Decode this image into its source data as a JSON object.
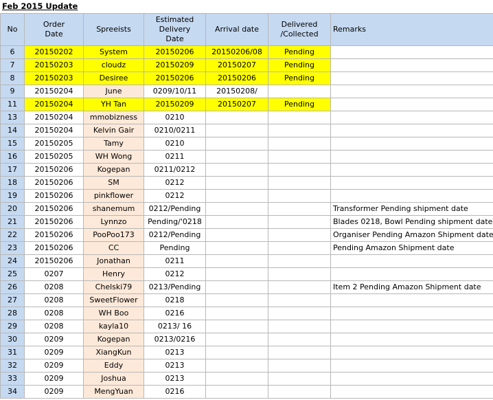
{
  "title": "Feb 2015 Update",
  "headers": {
    "no": "No",
    "order_date": "Order Date",
    "spreeists": "Spreeists",
    "est_delivery": "Estimated Delivery Date",
    "arrival": "Arrival date",
    "delivered": "Delivered /Collected",
    "remarks": "Remarks"
  },
  "colors": {
    "highlight": "#ffff00",
    "header": "#c5d9f1",
    "spreeist": "#fde9d9"
  },
  "rows": [
    {
      "no": "6",
      "order": "20150202",
      "name": "System",
      "est": "20150206",
      "arrival": "20150206/08",
      "delivered": "Pending",
      "remarks": "",
      "highlight": true
    },
    {
      "no": "7",
      "order": "20150203",
      "name": "cloudz",
      "est": "20150209",
      "arrival": "20150207",
      "delivered": "Pending",
      "remarks": "",
      "highlight": true
    },
    {
      "no": "8",
      "order": "20150203",
      "name": "Desiree",
      "est": "20150206",
      "arrival": "20150206",
      "delivered": "Pending",
      "remarks": "",
      "highlight": true
    },
    {
      "no": "9",
      "order": "20150204",
      "name": "June",
      "est": "0209/10/11",
      "arrival": "20150208/",
      "delivered": "",
      "remarks": "",
      "highlight": false
    },
    {
      "no": "11",
      "order": "20150204",
      "name": "YH Tan",
      "est": "20150209",
      "arrival": "20150207",
      "delivered": "Pending",
      "remarks": "",
      "highlight": true
    },
    {
      "no": "13",
      "order": "20150204",
      "name": "mmobizness",
      "est": "0210",
      "arrival": "",
      "delivered": "",
      "remarks": "",
      "highlight": false
    },
    {
      "no": "14",
      "order": "20150204",
      "name": "Kelvin Gair",
      "est": "0210/0211",
      "arrival": "",
      "delivered": "",
      "remarks": "",
      "highlight": false
    },
    {
      "no": "15",
      "order": "20150205",
      "name": "Tamy",
      "est": "0210",
      "arrival": "",
      "delivered": "",
      "remarks": "",
      "highlight": false
    },
    {
      "no": "16",
      "order": "20150205",
      "name": "WH Wong",
      "est": "0211",
      "arrival": "",
      "delivered": "",
      "remarks": "",
      "highlight": false
    },
    {
      "no": "17",
      "order": "20150206",
      "name": "Kogepan",
      "est": "0211/0212",
      "arrival": "",
      "delivered": "",
      "remarks": "",
      "highlight": false
    },
    {
      "no": "18",
      "order": "20150206",
      "name": "SM",
      "est": "0212",
      "arrival": "",
      "delivered": "",
      "remarks": "",
      "highlight": false
    },
    {
      "no": "19",
      "order": "20150206",
      "name": "pinkflower",
      "est": "0212",
      "arrival": "",
      "delivered": "",
      "remarks": "",
      "highlight": false
    },
    {
      "no": "20",
      "order": "20150206",
      "name": "shanemum",
      "est": "0212/Pending",
      "arrival": "",
      "delivered": "",
      "remarks": "Transformer Pending shipment date",
      "highlight": false
    },
    {
      "no": "21",
      "order": "20150206",
      "name": "Lynnzo",
      "est": "Pending/'0218",
      "arrival": "",
      "delivered": "",
      "remarks": "Blades 0218, Bowl Pending shipment date",
      "highlight": false
    },
    {
      "no": "22",
      "order": "20150206",
      "name": "PooPoo173",
      "est": "0212/Pending",
      "arrival": "",
      "delivered": "",
      "remarks": "Organiser Pending Amazon Shipment date",
      "highlight": false
    },
    {
      "no": "23",
      "order": "20150206",
      "name": "CC",
      "est": "Pending",
      "arrival": "",
      "delivered": "",
      "remarks": "Pending Amazon Shipment date",
      "highlight": false
    },
    {
      "no": "24",
      "order": "20150206",
      "name": "Jonathan",
      "est": "0211",
      "arrival": "",
      "delivered": "",
      "remarks": "",
      "highlight": false
    },
    {
      "no": "25",
      "order": "0207",
      "name": "Henry",
      "est": "0212",
      "arrival": "",
      "delivered": "",
      "remarks": "",
      "highlight": false
    },
    {
      "no": "26",
      "order": "0208",
      "name": "Chelski79",
      "est": "0213/Pending",
      "arrival": "",
      "delivered": "",
      "remarks": "Item 2 Pending Amazon Shipment date",
      "highlight": false
    },
    {
      "no": "27",
      "order": "0208",
      "name": "SweetFlower",
      "est": "0218",
      "arrival": "",
      "delivered": "",
      "remarks": "",
      "highlight": false
    },
    {
      "no": "28",
      "order": "0208",
      "name": "WH Boo",
      "est": "0216",
      "arrival": "",
      "delivered": "",
      "remarks": "",
      "highlight": false
    },
    {
      "no": "29",
      "order": "0208",
      "name": "kayla10",
      "est": "0213/ 16",
      "arrival": "",
      "delivered": "",
      "remarks": "",
      "highlight": false
    },
    {
      "no": "30",
      "order": "0209",
      "name": "Kogepan",
      "est": "0213/0216",
      "arrival": "",
      "delivered": "",
      "remarks": "",
      "highlight": false
    },
    {
      "no": "31",
      "order": "0209",
      "name": "XiangKun",
      "est": "0213",
      "arrival": "",
      "delivered": "",
      "remarks": "",
      "highlight": false
    },
    {
      "no": "32",
      "order": "0209",
      "name": "Eddy",
      "est": "0213",
      "arrival": "",
      "delivered": "",
      "remarks": "",
      "highlight": false
    },
    {
      "no": "33",
      "order": "0209",
      "name": "Joshua",
      "est": "0213",
      "arrival": "",
      "delivered": "",
      "remarks": "",
      "highlight": false
    },
    {
      "no": "34",
      "order": "0209",
      "name": "MengYuan",
      "est": "0216",
      "arrival": "",
      "delivered": "",
      "remarks": "",
      "highlight": false
    }
  ]
}
